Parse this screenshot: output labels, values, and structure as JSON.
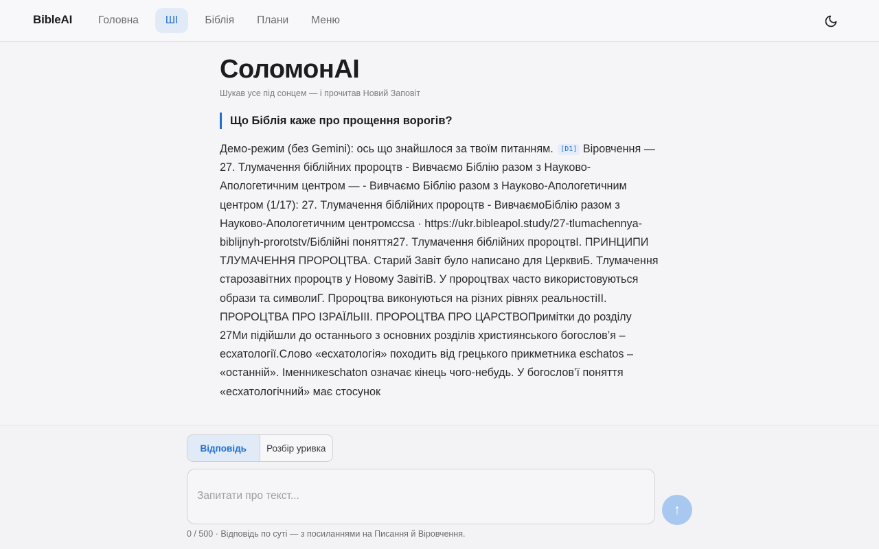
{
  "header": {
    "brand": "BibleAI",
    "nav": [
      {
        "label": "Головна"
      },
      {
        "label": "ШІ",
        "active": true
      },
      {
        "label": "Біблія"
      },
      {
        "label": "Плани"
      },
      {
        "label": "Меню"
      }
    ],
    "theme_icon": "moon-icon"
  },
  "main": {
    "title": "СоломонAI",
    "subtitle": "Шукав усе під сонцем — і прочитав Новий Заповіт",
    "question": "Що Біблія каже про прощення ворогів?",
    "answer_intro": "Демо-режим (без Gemini): ось що знайшлося за твоїм питанням.",
    "citation": "[D1]",
    "answer_body": "Віровчення — 27. Тлумачення біблійних пророцтв - Вивчаємо Біблію разом з Науково-Апологетичним центром — - Вивчаємо Біблію разом з Науково-Апологетичним центром (1/17): 27. Тлумачення біблійних пророцтв - ВивчаємоБіблію разом з Науково-Апологетичним центромccsa · https://ukr.bibleapol.study/27-tlumachennya-biblijnyh-prorotstv/Біблійні поняття27. Тлумачення біблійних пророцтвI. ПРИНЦИПИ ТЛУМАЧЕННЯ ПРОРОЦТВА. Старий Завіт було написано для ЦерквиБ. Тлумачення старозавітних пророцтв у Новому ЗавітіВ. У пророцтвах часто використовуються образи та символиГ. Пророцтва виконуються на різних рівнях реальностіII. ПРОРОЦТВА ПРО ІЗРАЇЛЬIII. ПРОРОЦТВА ПРО ЦАРСТВОПримітки до розділу 27Ми підійшли до останнього з основних розділів християнського богослов’я – есхатології.Слово «есхатологія» походить від грецького прикметника eschatos – «останній». Іменникeschaton означає кінець чого-небудь. У богослов’ї поняття «есхатологічний» має стосунок"
  },
  "composer": {
    "modes": [
      {
        "label": "Відповідь",
        "active": true
      },
      {
        "label": "Розбір уривка"
      }
    ],
    "input_value": "",
    "input_placeholder": "Запитати про текст...",
    "send_icon": "arrow-up-icon",
    "send_label": "↑",
    "hint": "0 / 500 · Відповідь по суті — з посиланнями на Писання й Віровчення."
  },
  "colors": {
    "accent": "#1f6fd0",
    "active_bg": "#e1ebf7",
    "send_button": "#a8c8f0"
  }
}
